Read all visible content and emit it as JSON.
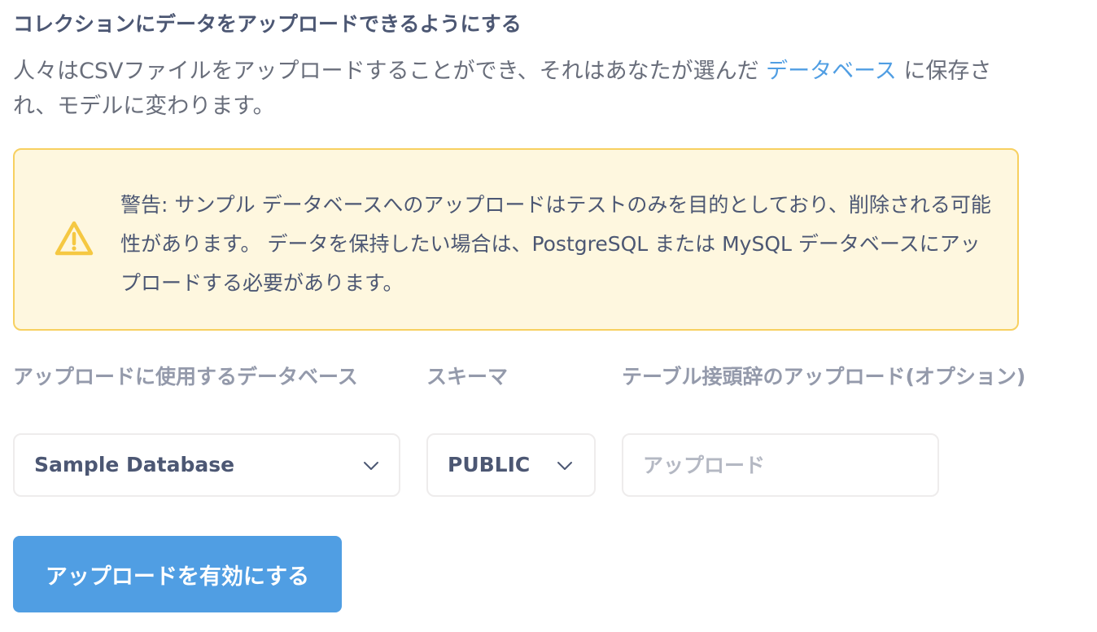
{
  "section": {
    "title": "コレクションにデータをアップロードできるようにする",
    "description_before_link": "人々はCSVファイルをアップロードすることができ、それはあなたが選んだ ",
    "description_link": "データベース",
    "description_after_link": " に保存され、モデルに変わります。"
  },
  "warning": {
    "icon": "warning-triangle-icon",
    "text": "警告: サンプル データベースへのアップロードはテストのみを目的としており、削除される可能性があります。 データを保持したい場合は、PostgreSQL または MySQL データベースにアップロードする必要があります。"
  },
  "fields": {
    "database": {
      "label": "アップロードに使用するデータベース",
      "value": "Sample Database",
      "icon": "chevron-down-icon"
    },
    "schema": {
      "label": "スキーマ",
      "value": "PUBLIC",
      "icon": "chevron-down-icon"
    },
    "prefix": {
      "label": "テーブル接頭辞のアップロード(オプション)",
      "placeholder": "アップロード",
      "value": ""
    }
  },
  "actions": {
    "enable_label": "アップロードを有効にする"
  },
  "colors": {
    "accent": "#509ee3",
    "warning_bg": "#fef7df",
    "warning_border": "#f7d060",
    "text_dark": "#4c5773",
    "text_muted": "#949aab"
  }
}
